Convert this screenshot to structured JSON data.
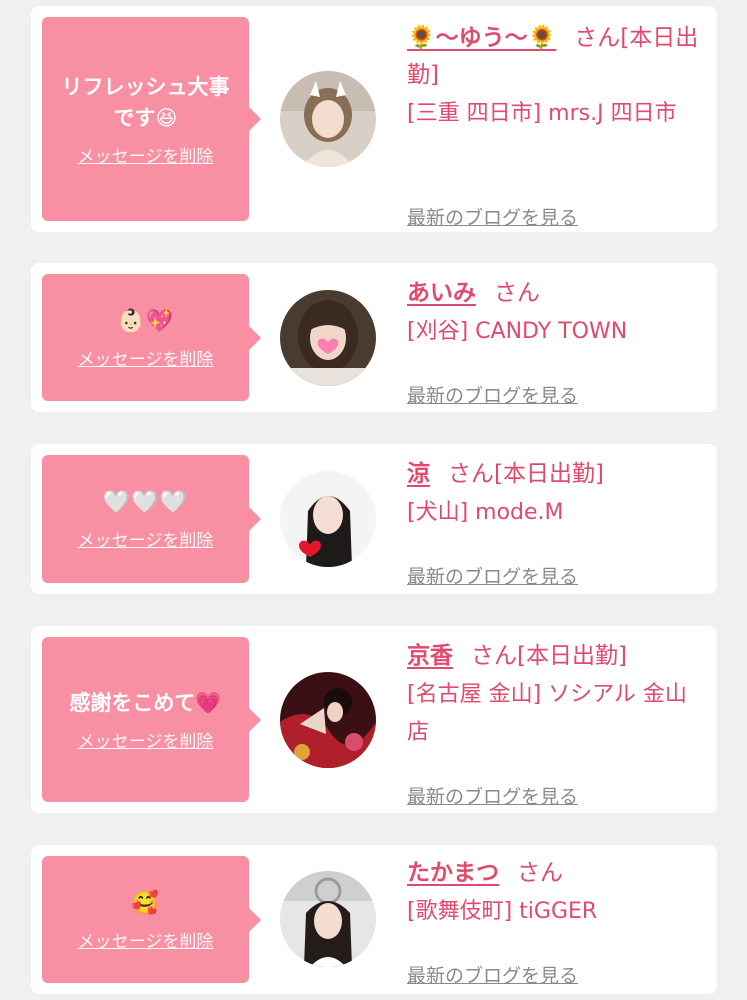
{
  "colors": {
    "accent": "#e24a6d",
    "bubble": "#f98fa3",
    "link_gray": "#8a8a8a",
    "background": "#f0f0f0"
  },
  "delete_label": "メッセージを削除",
  "blog_label": "最新のブログを見る",
  "cards": [
    {
      "message": "リフレッシュ大事です😆",
      "name": "🌻〜ゆう〜🌻",
      "suffix": "さん[本日出勤]",
      "shop": "[三重 四日市] mrs.J 四日市"
    },
    {
      "message": "👶🏻💖",
      "name": "あいみ",
      "suffix": "さん",
      "shop": "[刈谷] CANDY TOWN"
    },
    {
      "message": "🤍🤍🤍",
      "name": "涼",
      "suffix": "さん[本日出勤]",
      "shop": "[犬山] mode.M"
    },
    {
      "message": "感謝をこめて💗",
      "name": "京香",
      "suffix": "さん[本日出勤]",
      "shop": "[名古屋 金山] ソシアル 金山店"
    },
    {
      "message": "🥰",
      "name": "たかまつ",
      "suffix": "さん",
      "shop": "[歌舞伎町] tiGGER"
    }
  ]
}
